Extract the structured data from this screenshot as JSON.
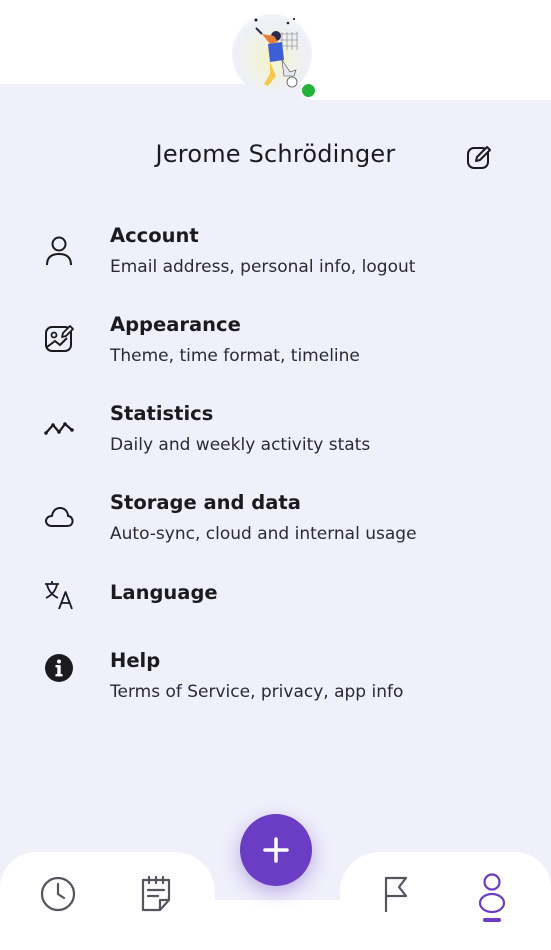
{
  "profile": {
    "user_name": "Jerome Schrödinger",
    "avatar": "avatar-illustration",
    "status": "online",
    "status_color": "#22b33a"
  },
  "menu": {
    "items": [
      {
        "icon": "person-icon",
        "title": "Account",
        "subtitle": "Email address, personal info, logout"
      },
      {
        "icon": "image-edit-icon",
        "title": "Appearance",
        "subtitle": "Theme, time format, timeline"
      },
      {
        "icon": "trend-line-icon",
        "title": "Statistics",
        "subtitle": "Daily and weekly activity stats"
      },
      {
        "icon": "cloud-icon",
        "title": "Storage and data",
        "subtitle": "Auto-sync, cloud and internal usage"
      },
      {
        "icon": "translate-icon",
        "title": "Language",
        "subtitle": ""
      },
      {
        "icon": "info-icon",
        "title": "Help",
        "subtitle": "Terms of Service, privacy, app info"
      }
    ]
  },
  "bottom_nav": {
    "items": [
      {
        "icon": "clock-icon",
        "active": false
      },
      {
        "icon": "note-icon",
        "active": false
      },
      {
        "icon": "flag-icon",
        "active": false
      },
      {
        "icon": "profile-icon",
        "active": true
      }
    ],
    "fab_icon": "plus-icon"
  },
  "colors": {
    "accent": "#6a3dc4",
    "panel_background": "#f0f0fb",
    "text": "#1b1b1f"
  }
}
